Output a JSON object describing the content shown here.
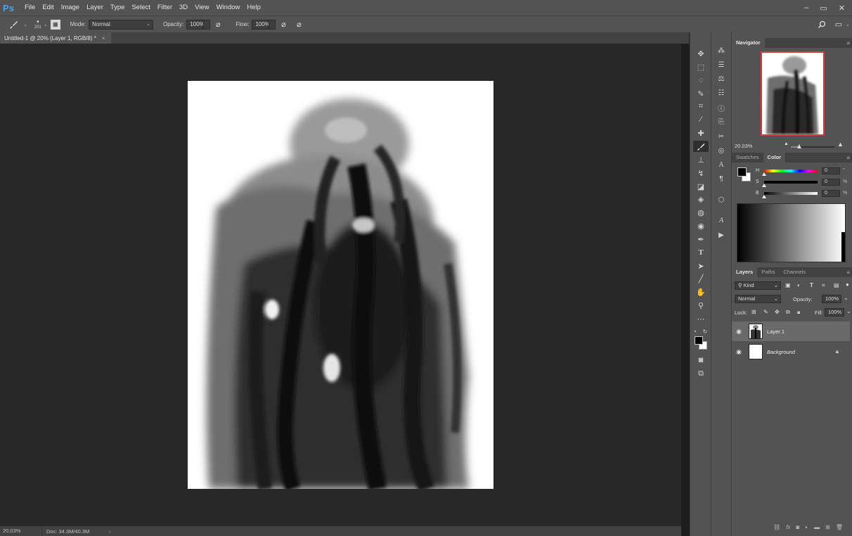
{
  "app": {
    "logo": "Ps"
  },
  "menu": [
    "File",
    "Edit",
    "Image",
    "Layer",
    "Type",
    "Select",
    "Filter",
    "3D",
    "View",
    "Window",
    "Help"
  ],
  "window_controls": [
    "–",
    "▭",
    "✕"
  ],
  "options_bar": {
    "brush_size": "201",
    "mode_label": "Mode:",
    "mode_value": "Normal",
    "opacity_label": "Opacity:",
    "opacity_value": "100%",
    "flow_label": "Flow:",
    "flow_value": "100%"
  },
  "document_tab": {
    "title": "Untitled-1 @ 20% (Layer 1, RGB/8) *",
    "close": "×"
  },
  "status_bar": {
    "zoom": "20.03%",
    "doc_info": "Doc: 34.3M/40.3M",
    "arrow": "›"
  },
  "navigator": {
    "tab": "Navigator",
    "zoom": "20.03%",
    "zoom_fraction": 0.2
  },
  "color_panel": {
    "tabs": [
      "Swatches",
      "Color"
    ],
    "active_tab": "Color",
    "rows": [
      {
        "label": "H",
        "value": "0",
        "unit": "°",
        "level": 0
      },
      {
        "label": "S",
        "value": "0",
        "unit": "%",
        "level": 0
      },
      {
        "label": "B",
        "value": "0",
        "unit": "%",
        "level": 0
      }
    ],
    "foreground": "#000000",
    "background": "#ffffff"
  },
  "layers_panel": {
    "tabs": [
      "Layers",
      "Paths",
      "Channels"
    ],
    "active_tab": "Layers",
    "filter_kind": "Kind",
    "blend_mode": "Normal",
    "opacity_label": "Opacity:",
    "opacity_value": "100%",
    "lock_label": "Lock:",
    "fill_label": "Fill:",
    "fill_value": "100%",
    "layers": [
      {
        "name": "Layer 1",
        "selected": true,
        "locked": false
      },
      {
        "name": "Background",
        "selected": false,
        "locked": true
      }
    ]
  },
  "colors": {
    "accent": "#4aa3f0",
    "nav_frame": "#d23c3c",
    "panel_bg": "#535353",
    "canvas_bg": "#282828"
  }
}
